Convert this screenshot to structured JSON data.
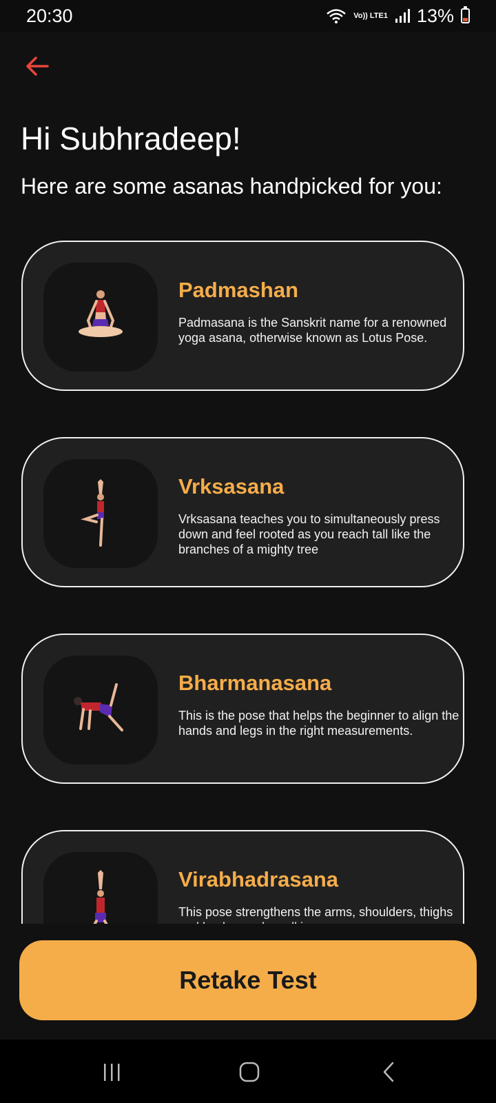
{
  "status_bar": {
    "time": "20:30",
    "network_label": "Vo)) LTE1",
    "battery_percent": "13%"
  },
  "header": {
    "greeting": "Hi Subhradeep!",
    "subtitle": "Here are some asanas handpicked for you:"
  },
  "asanas": [
    {
      "name": "Padmashan",
      "description": "Padmasana is the Sanskrit name for a renowned yoga asana, otherwise known as Lotus Pose.",
      "icon": "lotus-pose-icon"
    },
    {
      "name": "Vrksasana",
      "description": "Vrksasana teaches you to simultaneously press down and feel rooted as you reach tall like the branches of a mighty tree",
      "icon": "tree-pose-icon"
    },
    {
      "name": "Bharmanasana",
      "description": "This is the pose that helps the beginner to align the hands and legs in the right measurements.",
      "icon": "table-pose-icon"
    },
    {
      "name": "Virabhadrasana",
      "description": "This pose strengthens the arms, shoulders, thighs and back muscles, all in one go.",
      "icon": "warrior-pose-icon"
    }
  ],
  "footer": {
    "retake_label": "Retake Test"
  },
  "colors": {
    "accent": "#f5ad4a",
    "back_arrow": "#e8453c",
    "background": "#111111",
    "card_bg": "#202020"
  }
}
